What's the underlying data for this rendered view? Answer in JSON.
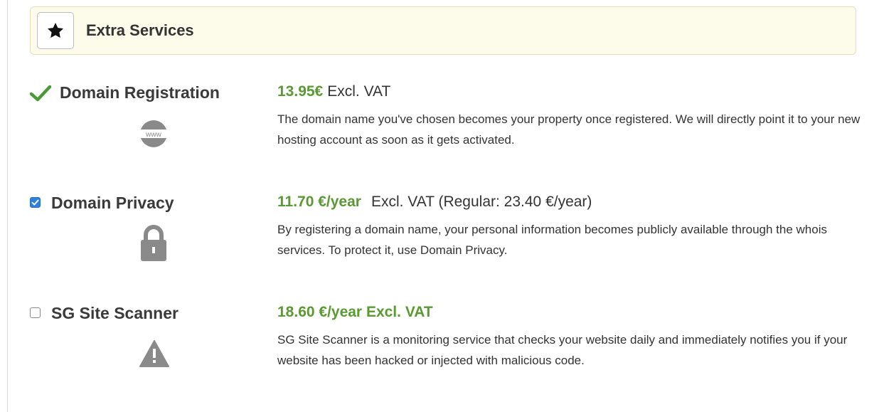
{
  "section": {
    "title": "Extra Services",
    "icon": "star-icon"
  },
  "services": [
    {
      "name": "Domain Registration",
      "state": "included",
      "state_icon": "check-icon",
      "icon": "www-globe-icon",
      "icon_text": "www",
      "price": "13.95€",
      "price_note": "Excl. VAT",
      "description": "The domain name you've chosen becomes your property once registered. We will directly point it to your new hosting account as soon as it gets activated."
    },
    {
      "name": "Domain Privacy",
      "state": "checked",
      "icon": "lock-icon",
      "price": "11.70 €/year",
      "price_note": "Excl. VAT (Regular: 23.40 €/year)",
      "description": "By registering a domain name, your personal information becomes publicly available through the whois services. To protect it, use Domain Privacy."
    },
    {
      "name": "SG Site Scanner",
      "state": "unchecked",
      "icon": "warning-icon",
      "price": "18.60 €/year Excl. VAT",
      "price_note": "",
      "description": "SG Site Scanner is a monitoring service that checks your website daily and immediately notifies you if your website has been hacked or injected with malicious code."
    }
  ],
  "colors": {
    "price_green": "#5a9a32",
    "check_green": "#4a9a3a",
    "checkbox_blue": "#2f7fe0",
    "header_bg": "#fdfbea",
    "icon_gray": "#8a8a8a"
  }
}
